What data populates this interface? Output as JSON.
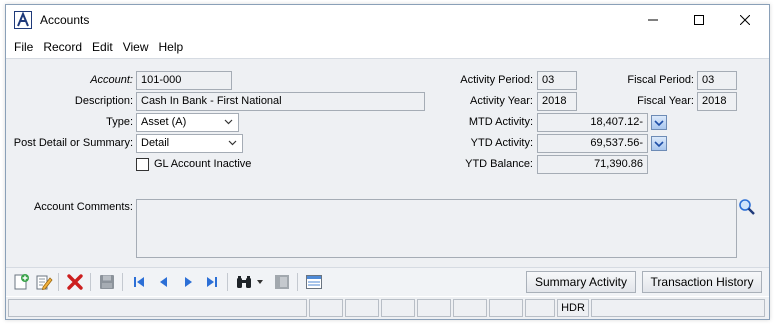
{
  "window": {
    "title": "Accounts"
  },
  "menu": {
    "items": [
      "File",
      "Record",
      "Edit",
      "View",
      "Help"
    ]
  },
  "form": {
    "account_label": "Account:",
    "account_value": "101-000",
    "description_label": "Description:",
    "description_value": "Cash In Bank - First National",
    "type_label": "Type:",
    "type_value": "Asset (A)",
    "post_label": "Post Detail or Summary:",
    "post_value": "Detail",
    "inactive_label": "GL Account Inactive",
    "inactive_checked": false,
    "activity_period_label": "Activity Period:",
    "activity_period_value": "03",
    "fiscal_period_label": "Fiscal Period:",
    "fiscal_period_value": "03",
    "activity_year_label": "Activity Year:",
    "activity_year_value": "2018",
    "fiscal_year_label": "Fiscal Year:",
    "fiscal_year_value": "2018",
    "mtd_label": "MTD Activity:",
    "mtd_value": "18,407.12-",
    "ytd_label": "YTD Activity:",
    "ytd_value": "69,537.56-",
    "ytd_balance_label": "YTD Balance:",
    "ytd_balance_value": "71,390.86",
    "comments_label": "Account Comments:",
    "comments_value": ""
  },
  "toolbar": {
    "icons": [
      "new-record-icon",
      "edit-record-icon",
      "delete-icon",
      "save-icon",
      "first-record-icon",
      "previous-record-icon",
      "next-record-icon",
      "last-record-icon",
      "find-icon",
      "dropdown-arrow-icon",
      "lookup-icon",
      "list-view-icon"
    ],
    "summary_activity_label": "Summary Activity",
    "transaction_history_label": "Transaction History"
  },
  "statusbar": {
    "mode": "HDR"
  },
  "colors": {
    "accent": "#1f4fa8",
    "delete": "#cc1f1f",
    "nav": "#2c6fd6"
  }
}
